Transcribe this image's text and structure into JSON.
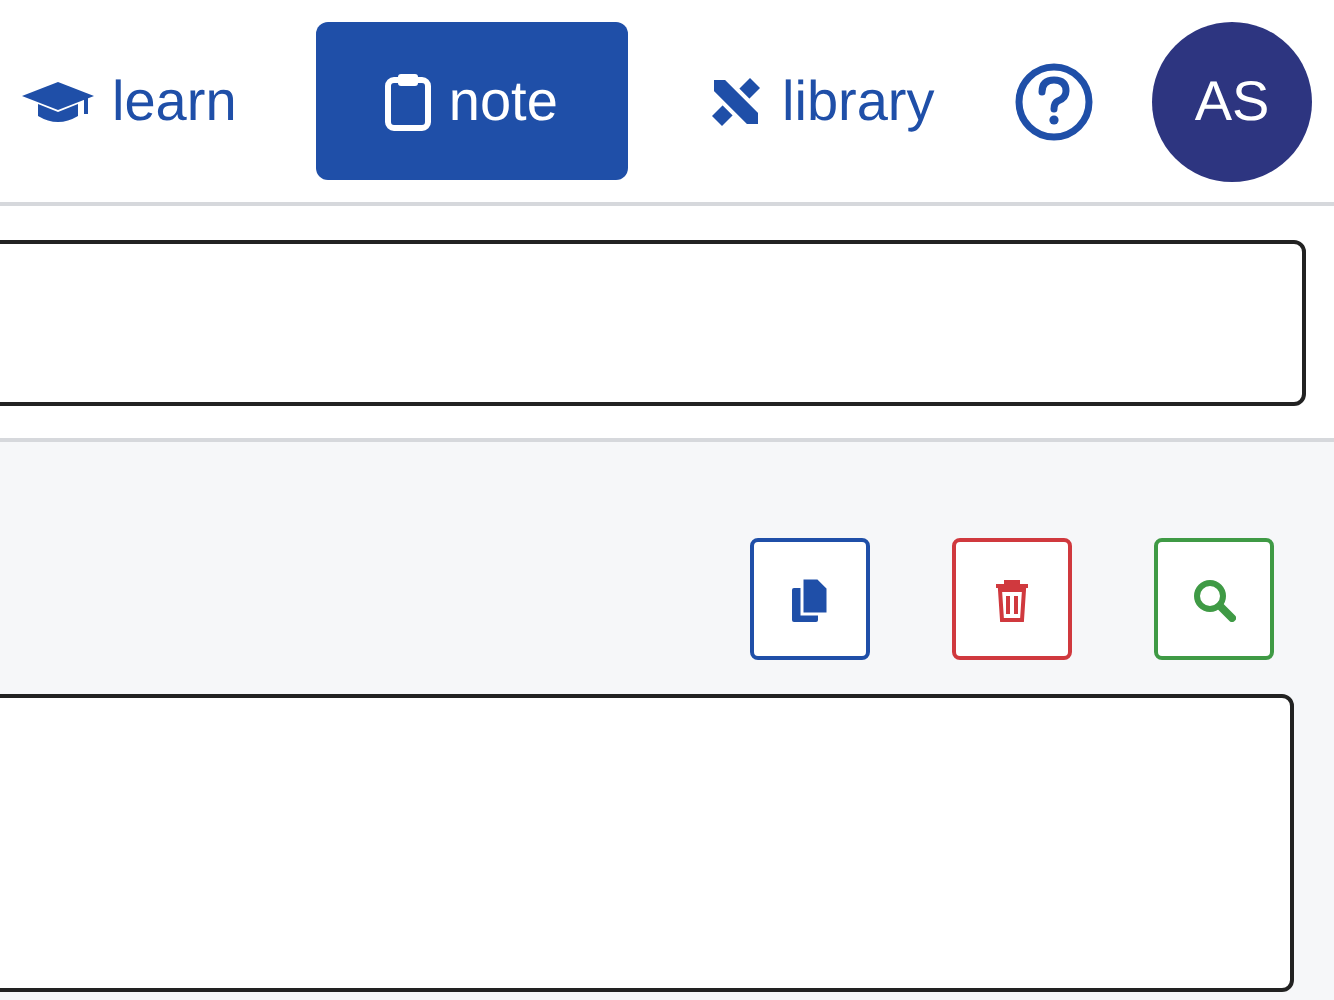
{
  "nav": [
    {
      "label": "learn",
      "kind": "cap",
      "selected": false
    },
    {
      "label": "note",
      "kind": "clipboard",
      "selected": true
    },
    {
      "label": "library",
      "kind": "tools",
      "selected": false
    }
  ],
  "avatar": {
    "initials": "AS"
  },
  "actions": [
    {
      "kind": "copy",
      "color": "#1f4fa8"
    },
    {
      "kind": "delete",
      "color": "#d0393e"
    },
    {
      "kind": "search",
      "color": "#3f9a45"
    }
  ]
}
